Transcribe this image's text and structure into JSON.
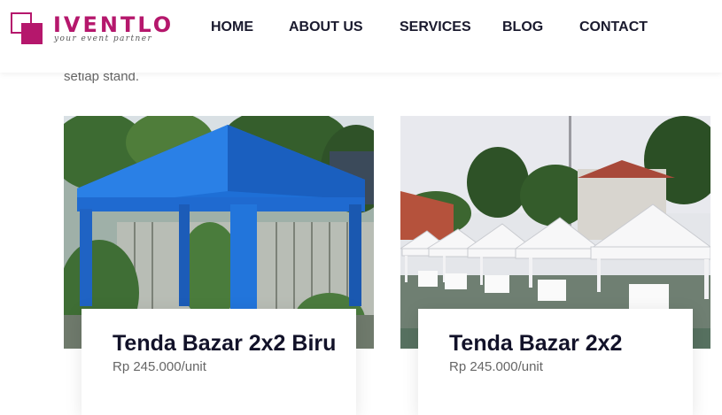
{
  "header": {
    "logo": {
      "name": "IVENTLO",
      "tagline": "your event partner",
      "brand_color": "#b5176c"
    },
    "nav": [
      "HOME",
      "ABOUT US",
      "SERVICES",
      "BLOG",
      "CONTACT"
    ]
  },
  "intro_text": "setiap stand.",
  "products": [
    {
      "title": "Tenda Bazar 2x2 Biru",
      "price": "Rp 245.000/unit",
      "image": "blue-tent-photo"
    },
    {
      "title": "Tenda Bazar 2x2",
      "price": "Rp 245.000/unit",
      "image": "white-tents-photo"
    }
  ]
}
